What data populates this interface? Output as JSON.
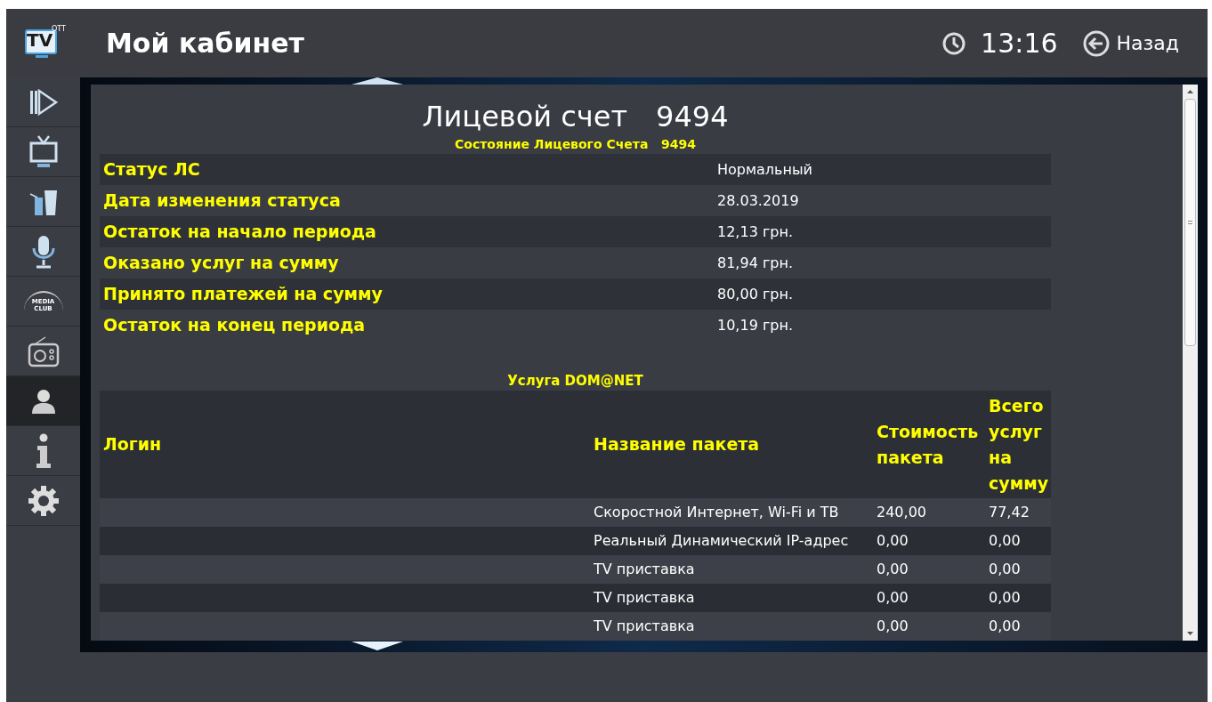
{
  "header": {
    "logo": {
      "text": "TV",
      "superscript": "OTT"
    },
    "title": "Мой кабинет",
    "time": "13:16",
    "back": "Назад"
  },
  "sidebar": {
    "items": [
      {
        "kind": "play",
        "selected": false
      },
      {
        "kind": "tv",
        "selected": false
      },
      {
        "kind": "drinks",
        "selected": false
      },
      {
        "kind": "microphone",
        "selected": false
      },
      {
        "kind": "mediaclub",
        "selected": false,
        "lines": [
          "MEDIA",
          "CLUB"
        ]
      },
      {
        "kind": "radio",
        "selected": false
      },
      {
        "kind": "user",
        "selected": true
      },
      {
        "kind": "info",
        "selected": false
      },
      {
        "kind": "settings",
        "selected": false
      }
    ]
  },
  "account": {
    "title": "Лицевой счет",
    "number": "9494",
    "subtitle": "Состояние Лицевого Счета   9494",
    "rows": [
      {
        "label": "Статус ЛС",
        "value": "Нормальный"
      },
      {
        "label": "Дата изменения статуса",
        "value": "28.03.2019"
      },
      {
        "label": "Остаток на начало периода",
        "value": "12,13 грн."
      },
      {
        "label": "Оказано услуг на сумму",
        "value": "81,94 грн."
      },
      {
        "label": "Принято платежей на сумму",
        "value": "80,00 грн."
      },
      {
        "label": "Остаток на конец периода",
        "value": "10,19 грн."
      }
    ]
  },
  "service": {
    "title": "Услуга DOM@NET",
    "columns": [
      "Логин",
      "Название пакета",
      "Стоимость пакета",
      "Всего услуг на сумму"
    ],
    "rows": [
      [
        "",
        "Скоростной Интернет, Wi-Fi и ТВ",
        "240,00",
        "77,42"
      ],
      [
        "",
        "Реальный Динамический IP-адрес",
        "0,00",
        "0,00"
      ],
      [
        "",
        "TV приставка",
        "0,00",
        "0,00"
      ],
      [
        "",
        "TV приставка",
        "0,00",
        "0,00"
      ],
      [
        "",
        "TV приставка",
        "0,00",
        "0,00"
      ]
    ]
  }
}
